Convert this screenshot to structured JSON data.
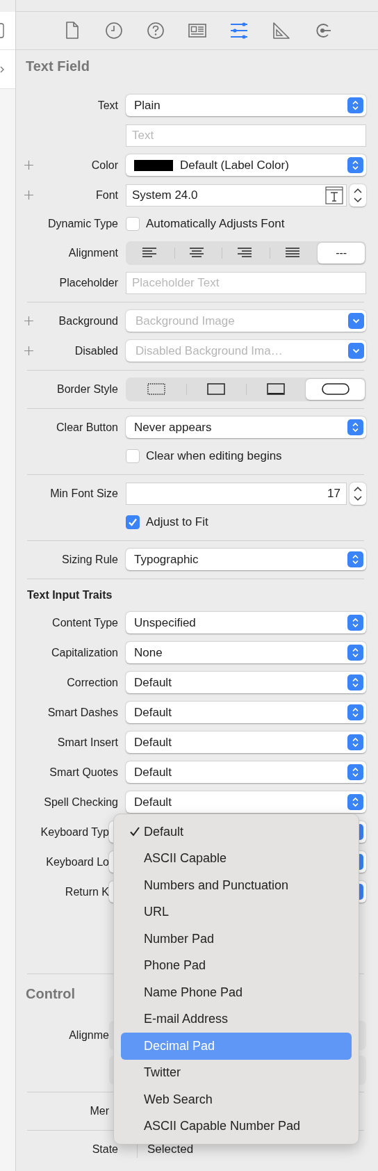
{
  "toolbar": [
    {
      "kind": "file",
      "selected": false
    },
    {
      "kind": "history",
      "selected": false
    },
    {
      "kind": "help",
      "selected": false
    },
    {
      "kind": "identity",
      "selected": false
    },
    {
      "kind": "attributes",
      "selected": true
    },
    {
      "kind": "size",
      "selected": false
    },
    {
      "kind": "connections",
      "selected": false
    }
  ],
  "sections": [
    {
      "title": "Text Field",
      "rows": [
        {
          "kind": "popup",
          "label": "Text",
          "value": "Plain"
        },
        {
          "kind": "field",
          "placeholder": "Text"
        },
        {
          "kind": "color",
          "label": "Color",
          "value": "Default (Label Color)",
          "color": "#000000",
          "addable": true
        },
        {
          "kind": "font",
          "label": "Font",
          "value": "System 24.0",
          "addable": true
        },
        {
          "kind": "checkbox",
          "label": "Dynamic Type",
          "text": "Automatically Adjusts Font",
          "checked": false
        },
        {
          "kind": "segmented",
          "label": "Alignment",
          "segments": [
            {
              "kind": "align-left",
              "selected": false
            },
            {
              "kind": "align-center",
              "selected": false
            },
            {
              "kind": "align-right",
              "selected": false
            },
            {
              "kind": "justify",
              "selected": false
            },
            {
              "kind": "natural",
              "text": "---",
              "selected": true
            }
          ]
        },
        {
          "kind": "field",
          "label": "Placeholder",
          "placeholder": "Placeholder Text"
        },
        {
          "kind": "divider"
        },
        {
          "kind": "combo",
          "label": "Background",
          "placeholder": "Background Image",
          "addable": true
        },
        {
          "kind": "combo",
          "label": "Disabled",
          "placeholder": "Disabled Background Ima…",
          "addable": true
        },
        {
          "kind": "divider"
        },
        {
          "kind": "segmented",
          "label": "Border Style",
          "segments": [
            {
              "kind": "border-none",
              "selected": false
            },
            {
              "kind": "border-line",
              "selected": false
            },
            {
              "kind": "border-bezel",
              "selected": false
            },
            {
              "kind": "border-rounded",
              "selected": true
            }
          ]
        },
        {
          "kind": "divider"
        },
        {
          "kind": "popup",
          "label": "Clear Button",
          "value": "Never appears"
        },
        {
          "kind": "checkbox",
          "text": "Clear when editing begins",
          "checked": false
        },
        {
          "kind": "divider"
        },
        {
          "kind": "number",
          "label": "Min Font Size",
          "value": "17"
        },
        {
          "kind": "checkbox",
          "text": "Adjust to Fit",
          "checked": true
        },
        {
          "kind": "divider"
        },
        {
          "kind": "popup",
          "label": "Sizing Rule",
          "value": "Typographic"
        },
        {
          "kind": "divider"
        },
        {
          "kind": "subheading",
          "text": "Text Input Traits"
        },
        {
          "kind": "popup",
          "label": "Content Type",
          "value": "Unspecified"
        },
        {
          "kind": "popup",
          "label": "Capitalization",
          "value": "None"
        },
        {
          "kind": "popup",
          "label": "Correction",
          "value": "Default"
        },
        {
          "kind": "popup",
          "label": "Smart Dashes",
          "value": "Default"
        },
        {
          "kind": "popup",
          "label": "Smart Insert",
          "value": "Default"
        },
        {
          "kind": "popup",
          "label": "Smart Quotes",
          "value": "Default"
        },
        {
          "kind": "popup",
          "label": "Spell Checking",
          "value": "Default"
        },
        {
          "kind": "covered-popup",
          "label": "Keyboard Typ"
        },
        {
          "kind": "covered-popup",
          "label": "Keyboard Lo"
        },
        {
          "kind": "covered-popup",
          "label": "Return K"
        },
        {
          "kind": "gap"
        },
        {
          "kind": "gap"
        },
        {
          "kind": "divider"
        }
      ]
    },
    {
      "title": "Control",
      "rows": [
        {
          "kind": "covered-segmented",
          "label": "Alignme"
        },
        {
          "kind": "covered-segmented"
        },
        {
          "kind": "divider"
        },
        {
          "kind": "covered-label",
          "label": "Mer"
        },
        {
          "kind": "divider"
        },
        {
          "kind": "plain",
          "label": "State",
          "value": "Selected"
        }
      ]
    }
  ],
  "menu": {
    "items": [
      {
        "label": "Default",
        "selected": true,
        "highlighted": false
      },
      {
        "label": "ASCII Capable",
        "selected": false,
        "highlighted": false
      },
      {
        "label": "Numbers and Punctuation",
        "selected": false,
        "highlighted": false
      },
      {
        "label": "URL",
        "selected": false,
        "highlighted": false
      },
      {
        "label": "Number Pad",
        "selected": false,
        "highlighted": false
      },
      {
        "label": "Phone Pad",
        "selected": false,
        "highlighted": false
      },
      {
        "label": "Name Phone Pad",
        "selected": false,
        "highlighted": false
      },
      {
        "label": "E-mail Address",
        "selected": false,
        "highlighted": false
      },
      {
        "label": "Decimal Pad",
        "selected": false,
        "highlighted": true
      },
      {
        "label": "Twitter",
        "selected": false,
        "highlighted": false
      },
      {
        "label": "Web Search",
        "selected": false,
        "highlighted": false
      },
      {
        "label": "ASCII Capable Number Pad",
        "selected": false,
        "highlighted": false
      }
    ]
  }
}
